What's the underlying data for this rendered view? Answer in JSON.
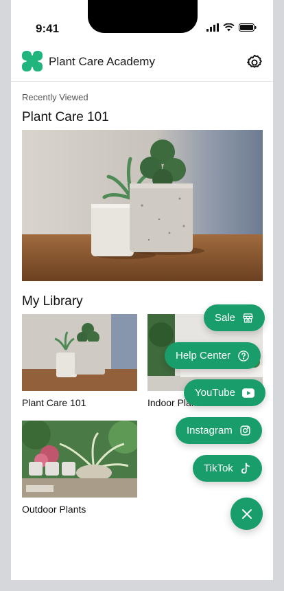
{
  "status": {
    "time": "9:41"
  },
  "header": {
    "title": "Plant Care Academy"
  },
  "recent": {
    "label": "Recently Viewed",
    "title": "Plant Care 101"
  },
  "library": {
    "title": "My Library",
    "items": [
      {
        "label": "Plant Care 101"
      },
      {
        "label": "Indoor Plants"
      },
      {
        "label": "Outdoor Plants"
      }
    ]
  },
  "menu": {
    "sale": "Sale",
    "help": "Help Center",
    "youtube": "YouTube",
    "instagram": "Instagram",
    "tiktok": "TikTok"
  },
  "colors": {
    "accent": "#199d6b"
  }
}
